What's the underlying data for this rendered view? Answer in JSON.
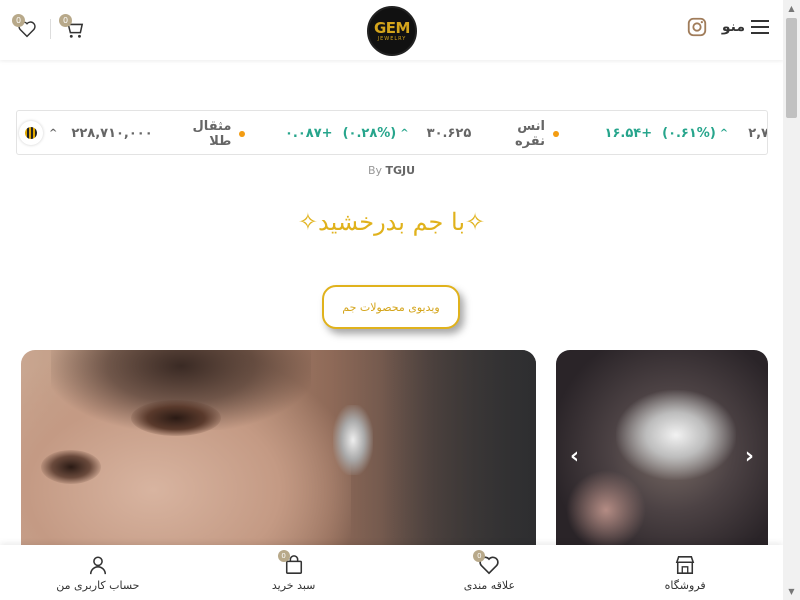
{
  "header": {
    "logo_text": "GEM",
    "logo_subtext": "JEWELRY",
    "menu_label": "منو",
    "wishlist_count": "0",
    "cart_count": "0"
  },
  "ticker": {
    "items": [
      {
        "name": "مثقال طلا",
        "value": "۲۲۸,۷۱۰,۰۰۰",
        "change_pct": "",
        "change": ""
      },
      {
        "name": "انس نقره",
        "value": "۳۰.۶۲۵",
        "change_pct": "(۰.۲۸%)",
        "change": "+۰.۰۸۷"
      },
      {
        "name": "",
        "value": "۲,۷",
        "change_pct": "(۰.۶۱%)",
        "change": "+۱۶.۵۴"
      }
    ],
    "credit_prefix": "By",
    "credit_name": "TGJU"
  },
  "heading": "✧با جم بدرخشید✧",
  "video_button_label": "ویدیوی محصولات جم",
  "slider": {
    "prev_icon": "chevron-left-icon",
    "next_icon": "chevron-right-icon"
  },
  "bottom_nav": {
    "items": [
      {
        "label": "فروشگاه",
        "icon": "store-icon",
        "badge": ""
      },
      {
        "label": "علاقه مندی",
        "icon": "heart-icon",
        "badge": "0"
      },
      {
        "label": "سبد خرید",
        "icon": "bag-icon",
        "badge": "0"
      },
      {
        "label": "حساب کاربری من",
        "icon": "user-icon",
        "badge": ""
      }
    ]
  },
  "colors": {
    "accent_gold": "#e0b21c",
    "ticker_up": "#27a58c",
    "ticker_dot": "#f39c12",
    "badge": "#b8a98a"
  }
}
